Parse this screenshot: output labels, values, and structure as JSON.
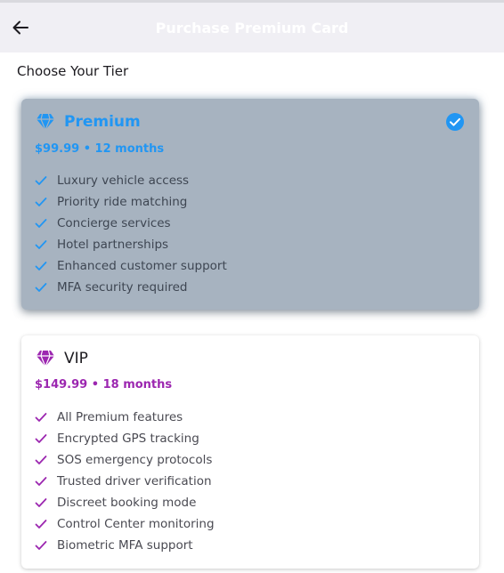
{
  "appbar": {
    "title": "Purchase Premium Card",
    "back_icon": "arrow-left-icon"
  },
  "section": {
    "title": "Choose Your Tier"
  },
  "tiers": [
    {
      "name": "Premium",
      "price": "$99.99 • 12 months",
      "selected": true,
      "color": "#2196f3",
      "icon": "diamond-icon",
      "features": [
        "Luxury vehicle access",
        "Priority ride matching",
        "Concierge services",
        "Hotel partnerships",
        "Enhanced customer support",
        "MFA security required"
      ]
    },
    {
      "name": "VIP",
      "price": "$149.99 • 18 months",
      "selected": false,
      "color": "#9c27b0",
      "icon": "diamond-icon",
      "features": [
        "All Premium features",
        "Encrypted GPS tracking",
        "SOS emergency protocols",
        "Trusted driver verification",
        "Discreet booking mode",
        "Control Center monitoring",
        "Biometric MFA support"
      ]
    }
  ]
}
